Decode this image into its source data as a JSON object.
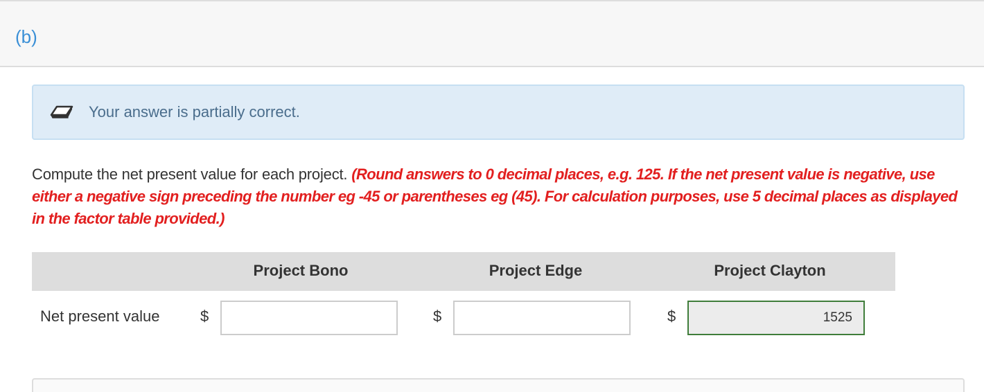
{
  "part": {
    "label": "(b)"
  },
  "feedback": {
    "icon": "eraser-icon",
    "message": "Your answer is partially correct."
  },
  "question": {
    "prompt": "Compute the net present value for each project.",
    "instruction": "(Round answers to 0 decimal places, e.g. 125. If the net present value is negative, use either a negative sign preceding the number eg -45 or parentheses eg (45). For calculation purposes, use 5 decimal places as displayed in the factor table provided.)"
  },
  "table": {
    "columns": [
      "Project Bono",
      "Project Edge",
      "Project Clayton"
    ],
    "row_label": "Net present value",
    "currency_symbol": "$",
    "values": [
      "",
      "",
      "1525"
    ]
  },
  "colors": {
    "part_label": "#3a8fd6",
    "instruction": "#e21f1f",
    "correct_border": "#3f7d3a",
    "feedback_bg": "#dfecf7"
  }
}
